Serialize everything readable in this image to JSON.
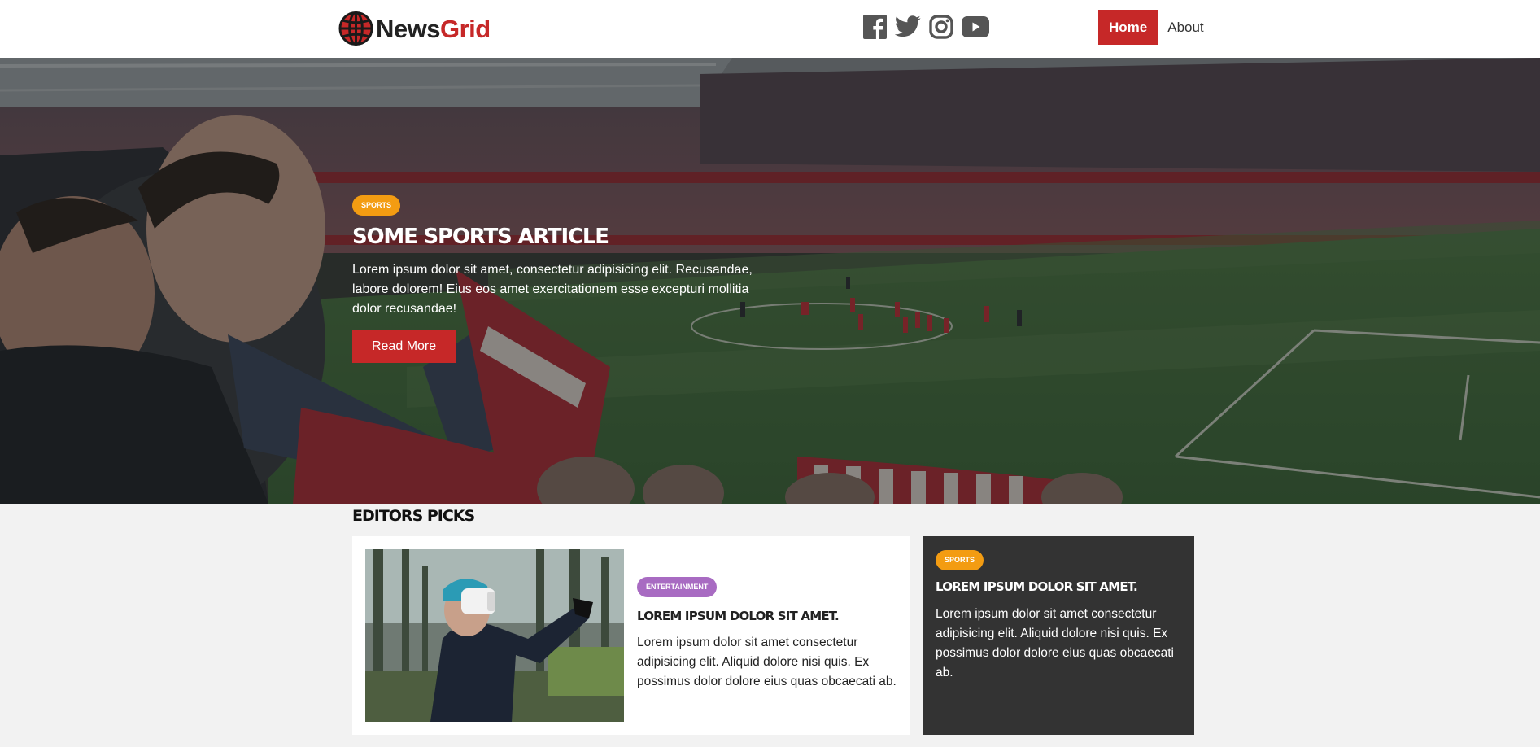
{
  "brand": {
    "news": "News",
    "grid": "Grid"
  },
  "social": [
    "facebook-icon",
    "twitter-icon",
    "instagram-icon",
    "youtube-icon"
  ],
  "nav": {
    "home": "Home",
    "about": "About"
  },
  "hero": {
    "category": "Sports",
    "title": "Some Sports Article",
    "text": "Lorem ipsum dolor sit amet, consectetur adipisicing elit. Recusandae, labore dolorem! Eius eos amet exercitationem esse excepturi mollitia dolor recusandae!",
    "button": "Read More"
  },
  "editors": {
    "title": "Editors Picks",
    "main": {
      "category": "Entertainment",
      "title": "Lorem ipsum dolor sit amet.",
      "text": "Lorem ipsum dolor sit amet consectetur adipisicing elit. Aliquid dolore nisi quis. Ex possimus dolor dolore eius quas obcaecati ab."
    },
    "side": {
      "category": "Sports",
      "title": "Lorem ipsum dolor sit amet.",
      "text": "Lorem ipsum dolor sit amet consectetur adipisicing elit. Aliquid dolore nisi quis. Ex possimus dolor dolore eius quas obcaecati ab."
    }
  },
  "colors": {
    "brand_red": "#c62828",
    "sports_badge": "#f39c12",
    "entertainment_badge": "#a86bc2",
    "dark_card": "#333333",
    "page_bg": "#f2f2f2"
  }
}
